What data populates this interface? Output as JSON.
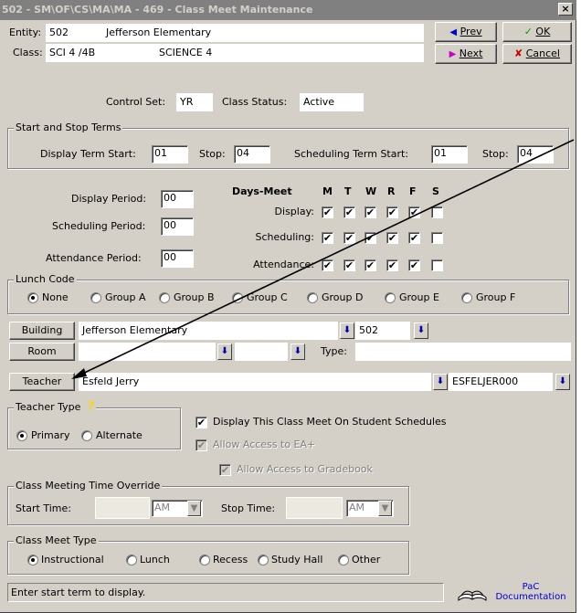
{
  "window": {
    "title": "502 - SM\\OF\\CS\\MA\\MA - 469 - Class Meet Maintenance",
    "close": "×"
  },
  "header": {
    "entity_label": "Entity:",
    "entity_code": "502",
    "entity_name": "Jefferson Elementary",
    "class_label": "Class:",
    "class_code": "SCI 4 /4B",
    "class_name": "SCIENCE 4",
    "control_set_label": "Control Set:",
    "control_set": "YR",
    "class_status_label": "Class Status:",
    "class_status": "Active"
  },
  "buttons": {
    "prev": "Prev",
    "next": "Next",
    "ok": "OK",
    "cancel": "Cancel"
  },
  "terms": {
    "group_title": "Start and Stop Terms",
    "display_start_label": "Display Term Start:",
    "display_start": "01",
    "display_stop_label": "Stop:",
    "display_stop": "04",
    "sched_start_label": "Scheduling Term Start:",
    "sched_start": "01",
    "sched_stop_label": "Stop:",
    "sched_stop": "04"
  },
  "periods": {
    "display_label": "Display Period:",
    "display": "00",
    "scheduling_label": "Scheduling Period:",
    "scheduling": "00",
    "attendance_label": "Attendance Period:",
    "attendance": "00"
  },
  "days_meet": {
    "title": "Days-Meet",
    "days": [
      "M",
      "T",
      "W",
      "R",
      "F",
      "S"
    ],
    "rows": [
      {
        "label": "Display:",
        "checks": [
          true,
          true,
          true,
          true,
          true,
          false
        ]
      },
      {
        "label": "Scheduling:",
        "checks": [
          true,
          true,
          true,
          true,
          true,
          false
        ]
      },
      {
        "label": "Attendance:",
        "checks": [
          true,
          true,
          true,
          true,
          true,
          false
        ]
      }
    ]
  },
  "lunch": {
    "group_title": "Lunch Code",
    "options": [
      "None",
      "Group A",
      "Group B",
      "Group C",
      "Group D",
      "Group E",
      "Group F"
    ],
    "selected": "None"
  },
  "building": {
    "button": "Building",
    "name": "Jefferson Elementary",
    "code": "502"
  },
  "room": {
    "button": "Room",
    "type_label": "Type:"
  },
  "teacher": {
    "button": "Teacher",
    "name": "Esfeld Jerry",
    "code": "ESFELJER000"
  },
  "teacher_type": {
    "group_title": "Teacher Type",
    "help": "?",
    "options": [
      "Primary",
      "Alternate"
    ],
    "selected": "Primary"
  },
  "options": {
    "display_on_schedules": "Display This Class Meet On Student Schedules",
    "allow_ea": "Allow Access to EA+",
    "allow_gradebook": "Allow Access to Gradebook"
  },
  "time_override": {
    "group_title": "Class Meeting Time Override",
    "start_label": "Start Time:",
    "start_ampm": "AM",
    "stop_label": "Stop Time:",
    "stop_ampm": "AM"
  },
  "meet_type": {
    "group_title": "Class Meet Type",
    "options": [
      "Instructional",
      "Lunch",
      "Recess",
      "Study Hall",
      "Other"
    ],
    "selected": "Instructional"
  },
  "status": {
    "message": "Enter start term to display.",
    "doc_line1": "PaC",
    "doc_line2": "Documentation"
  },
  "colors": {
    "face": "#d4d0c8",
    "titlebar": "#808080",
    "arrow_blue": "#0000cc",
    "ok_green": "#00a000",
    "cancel_red": "#cc0000"
  }
}
